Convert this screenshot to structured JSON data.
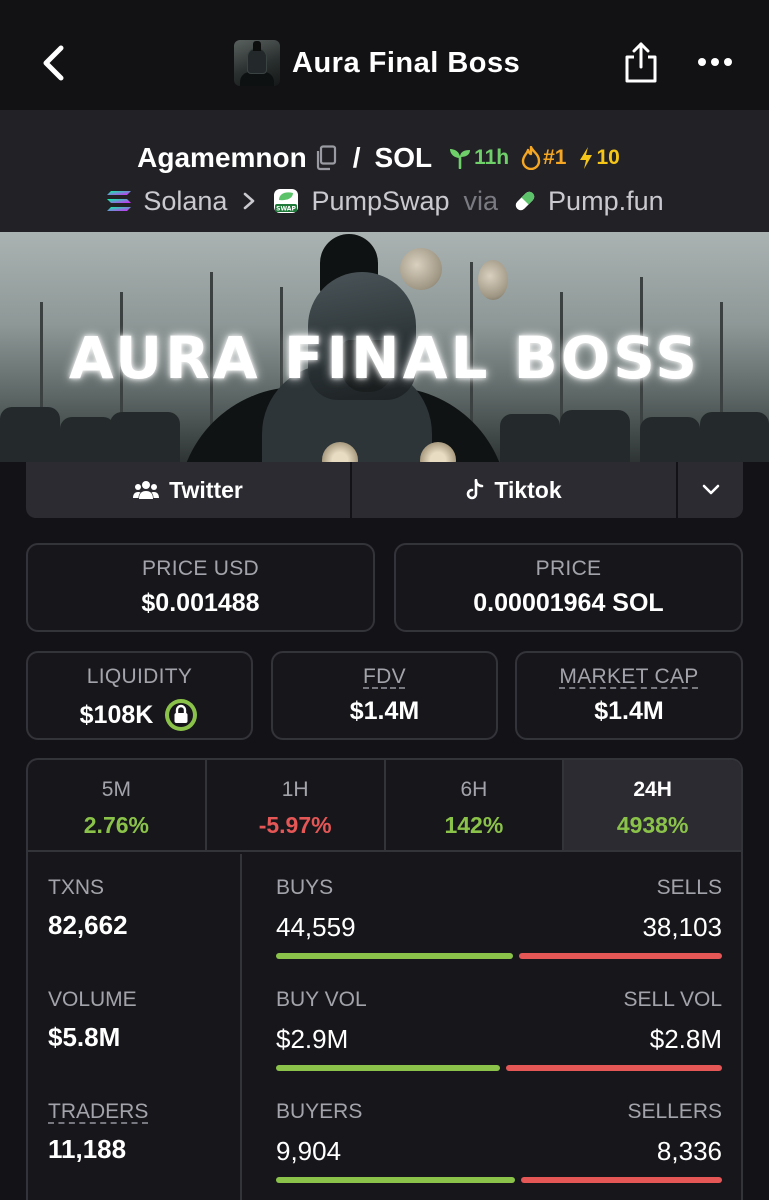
{
  "nav": {
    "title": "Aura Final Boss"
  },
  "pair": {
    "base": "Agamemnon",
    "separator": "/",
    "quote": "SOL",
    "age": "11h",
    "rank": "#1",
    "boost": "10"
  },
  "chain": {
    "network": "Solana",
    "dex": "PumpSwap",
    "via": "via",
    "launchpad": "Pump.fun",
    "dex_icon_text": "SWAP"
  },
  "banner": {
    "title": "AURA FINAL BOSS"
  },
  "socials": {
    "twitter": "Twitter",
    "tiktok": "Tiktok"
  },
  "price": {
    "usd_label": "PRICE USD",
    "usd_value": "$0.001488",
    "native_label": "PRICE",
    "native_value": "0.00001964 SOL"
  },
  "metrics": {
    "liquidity_label": "LIQUIDITY",
    "liquidity_value": "$108K",
    "fdv_label": "FDV",
    "fdv_value": "$1.4M",
    "mcap_label": "MARKET CAP",
    "mcap_value": "$1.4M"
  },
  "timeframes": [
    {
      "label": "5M",
      "change": "2.76%"
    },
    {
      "label": "1H",
      "change": "-5.97%"
    },
    {
      "label": "6H",
      "change": "142%"
    },
    {
      "label": "24H",
      "change": "4938%"
    }
  ],
  "active_timeframe": "24H",
  "stats": {
    "txns_label": "TXNS",
    "txns_value": "82,662",
    "volume_label": "VOLUME",
    "volume_value": "$5.8M",
    "traders_label": "TRADERS",
    "traders_value": "11,188",
    "buys_label": "BUYS",
    "buys_value": "44,559",
    "sells_label": "SELLS",
    "sells_value": "38,103",
    "buy_vol_label": "BUY VOL",
    "buy_vol_value": "$2.9M",
    "sell_vol_label": "SELL VOL",
    "sell_vol_value": "$2.8M",
    "buyers_label": "BUYERS",
    "buyers_value": "9,904",
    "sellers_label": "SELLERS",
    "sellers_value": "8,336"
  },
  "ratios": {
    "txns_buy_fraction": 0.539,
    "volume_buy_fraction": 0.509,
    "traders_buy_fraction": 0.543
  },
  "colors": {
    "positive": "#8bc34a",
    "negative": "#e55656",
    "badge_age": "#6fd06a",
    "badge_rank": "#f5a623",
    "badge_boost": "#f5c518",
    "background": "#131317"
  }
}
